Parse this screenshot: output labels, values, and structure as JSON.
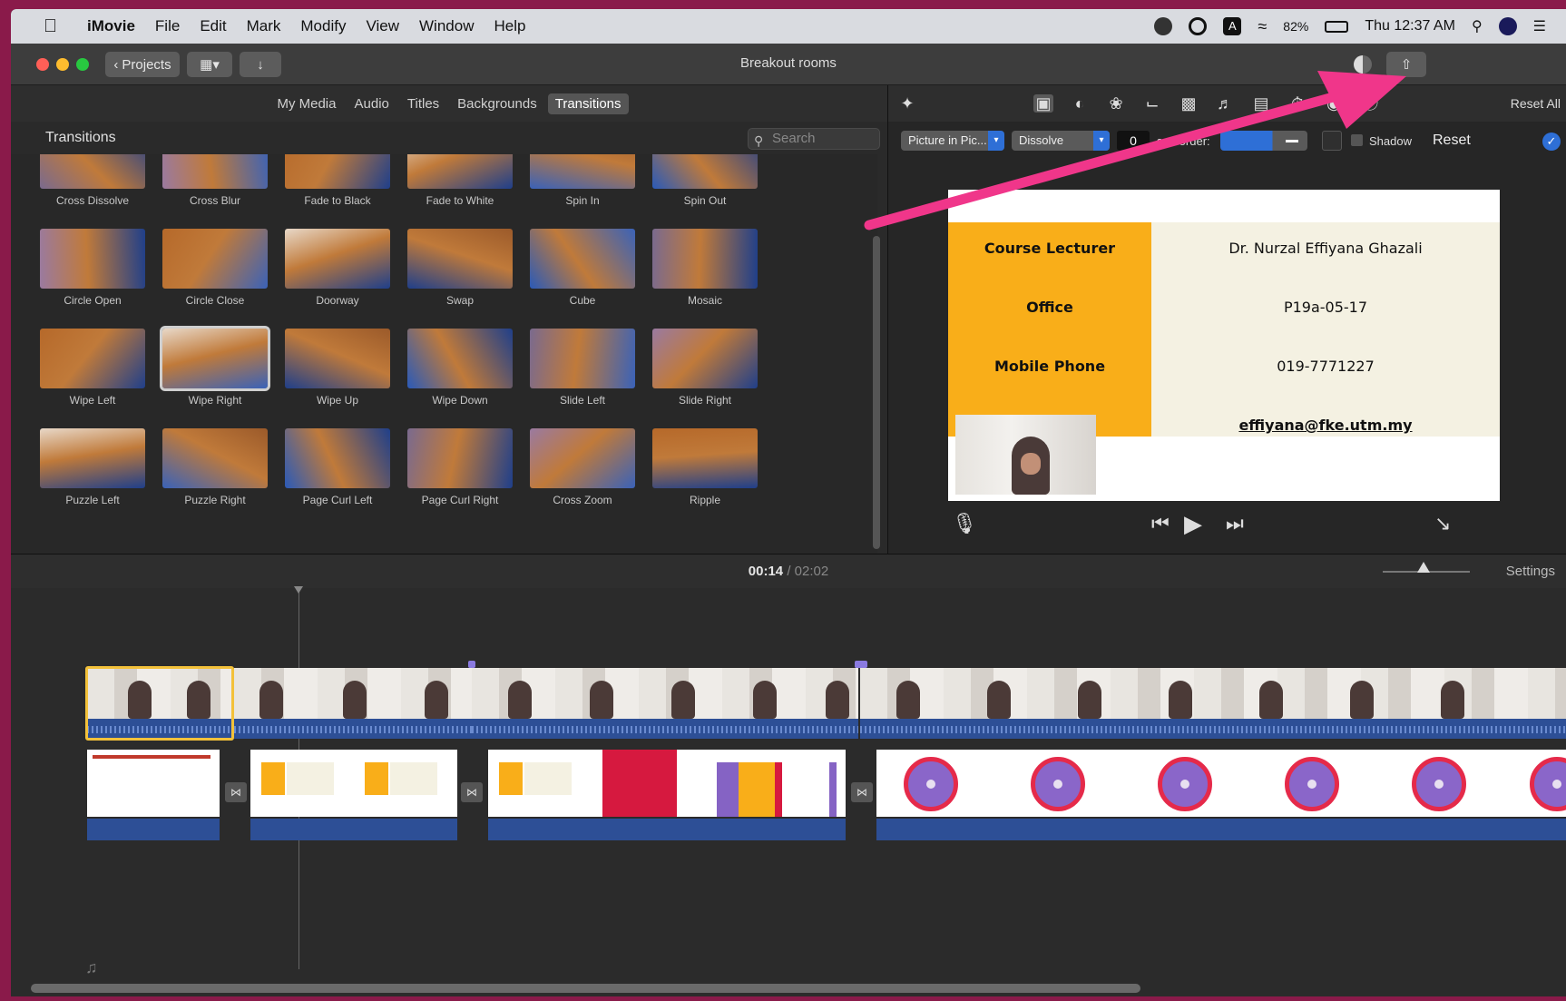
{
  "menubar": {
    "app": "iMovie",
    "items": [
      "File",
      "Edit",
      "Mark",
      "Modify",
      "View",
      "Window",
      "Help"
    ],
    "battery": "82%",
    "clock": "Thu 12:37 AM"
  },
  "toolbar": {
    "projects_label": "Projects",
    "window_title": "Breakout rooms"
  },
  "browser": {
    "tabs": [
      "My Media",
      "Audio",
      "Titles",
      "Backgrounds",
      "Transitions"
    ],
    "active_tab": "Transitions",
    "section_title": "Transitions",
    "search_placeholder": "Search",
    "transitions": [
      "Cross Dissolve",
      "Cross Blur",
      "Fade to Black",
      "Fade to White",
      "Spin In",
      "Spin Out",
      "Circle Open",
      "Circle Close",
      "Doorway",
      "Swap",
      "Cube",
      "Mosaic",
      "Wipe Left",
      "Wipe Right",
      "Wipe Up",
      "Wipe Down",
      "Slide Left",
      "Slide Right",
      "Puzzle Left",
      "Puzzle Right",
      "Page Curl Left",
      "Page Curl Right",
      "Cross Zoom",
      "Ripple"
    ],
    "selected": "Wipe Right"
  },
  "viewer": {
    "reset_all": "Reset All",
    "overlay_mode": "Picture in Pic...",
    "transition_style": "Dissolve",
    "duration": "0",
    "duration_unit": "s",
    "border_label": "Border:",
    "shadow_label": "Shadow",
    "reset_label": "Reset",
    "slide": {
      "rows": [
        {
          "label": "Course Lecturer",
          "value": "Dr. Nurzal Effiyana Ghazali"
        },
        {
          "label": "Office",
          "value": "P19a-05-17"
        },
        {
          "label": "Mobile Phone",
          "value": "019-7771227"
        },
        {
          "label": "",
          "value": "effiyana@fke.utm.my"
        }
      ]
    }
  },
  "timeline": {
    "current_time": "00:14",
    "separator": "/",
    "total_time": "02:02",
    "settings_label": "Settings"
  },
  "colors": {
    "accent": "#2e6fd6",
    "selection": "#f3c13a",
    "annotation_arrow": "#f0368a",
    "slide_orange": "#f9ae19"
  }
}
